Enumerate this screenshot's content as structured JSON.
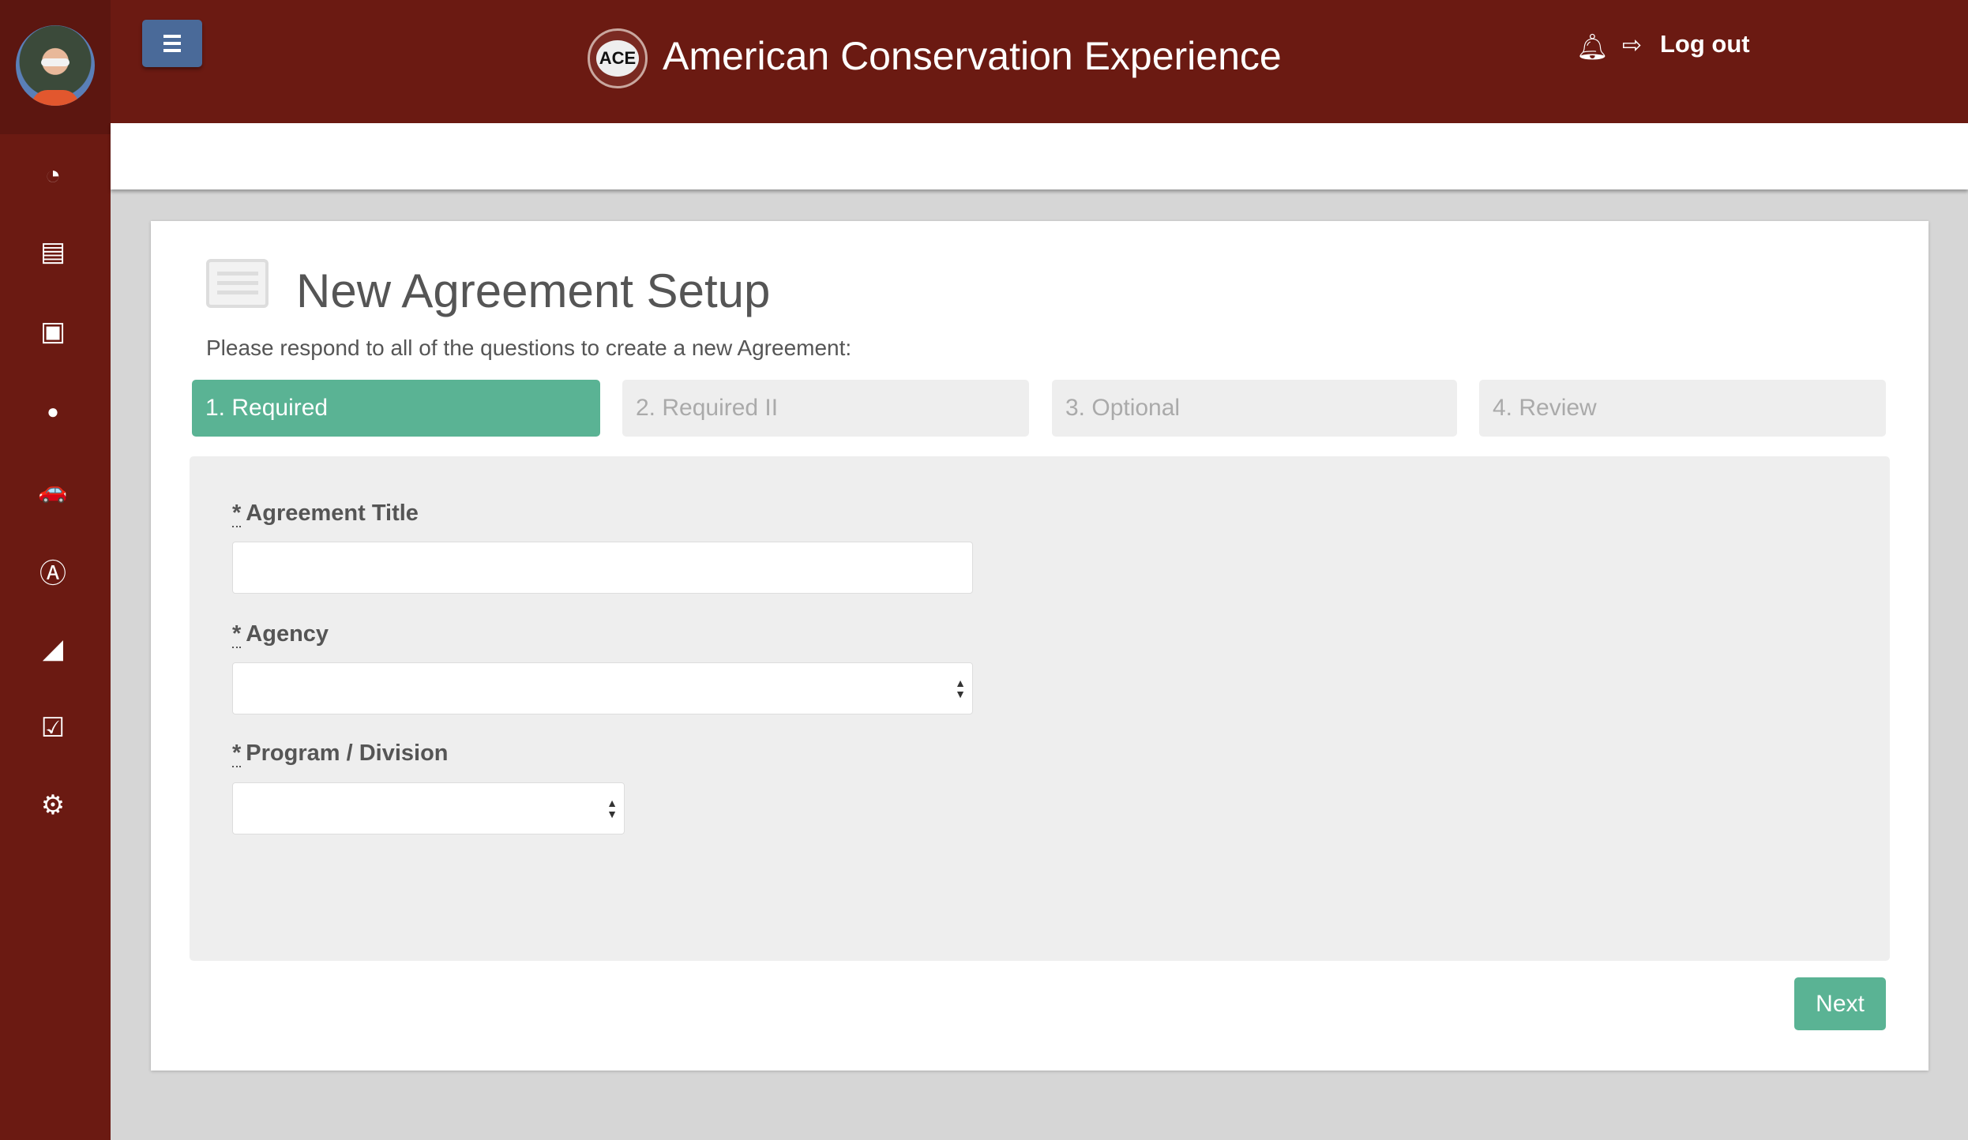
{
  "header": {
    "title": "American Conservation Experience",
    "logo_text": "ACE",
    "logout_label": "Log out"
  },
  "sidebar": {
    "items": [
      {
        "icon": "dashboard-icon",
        "glyph": "◔"
      },
      {
        "icon": "list-icon",
        "glyph": "▤"
      },
      {
        "icon": "id-card-icon",
        "glyph": "▣"
      },
      {
        "icon": "user-icon",
        "glyph": "●"
      },
      {
        "icon": "car-icon",
        "glyph": "🚗"
      },
      {
        "icon": "americorps-icon",
        "glyph": "Ⓐ"
      },
      {
        "icon": "area-chart-icon",
        "glyph": "◢"
      },
      {
        "icon": "check-square-icon",
        "glyph": "☑"
      },
      {
        "icon": "gears-icon",
        "glyph": "⚙"
      }
    ]
  },
  "page": {
    "title": "New Agreement Setup",
    "subtitle": "Please respond to all of the questions to create a new Agreement:",
    "tabs": [
      {
        "label": "1. Required",
        "active": true
      },
      {
        "label": "2. Required II",
        "active": false
      },
      {
        "label": "3. Optional",
        "active": false
      },
      {
        "label": "4. Review",
        "active": false
      }
    ],
    "form": {
      "required_marker": "*",
      "agreement_title": {
        "label": "Agreement Title",
        "value": ""
      },
      "agency": {
        "label": "Agency",
        "value": ""
      },
      "program": {
        "label": "Program / Division",
        "value": ""
      }
    },
    "next_label": "Next"
  },
  "colors": {
    "header": "#6b1a12",
    "accent_green": "#5ab394",
    "menu_button": "#4a6a99"
  }
}
